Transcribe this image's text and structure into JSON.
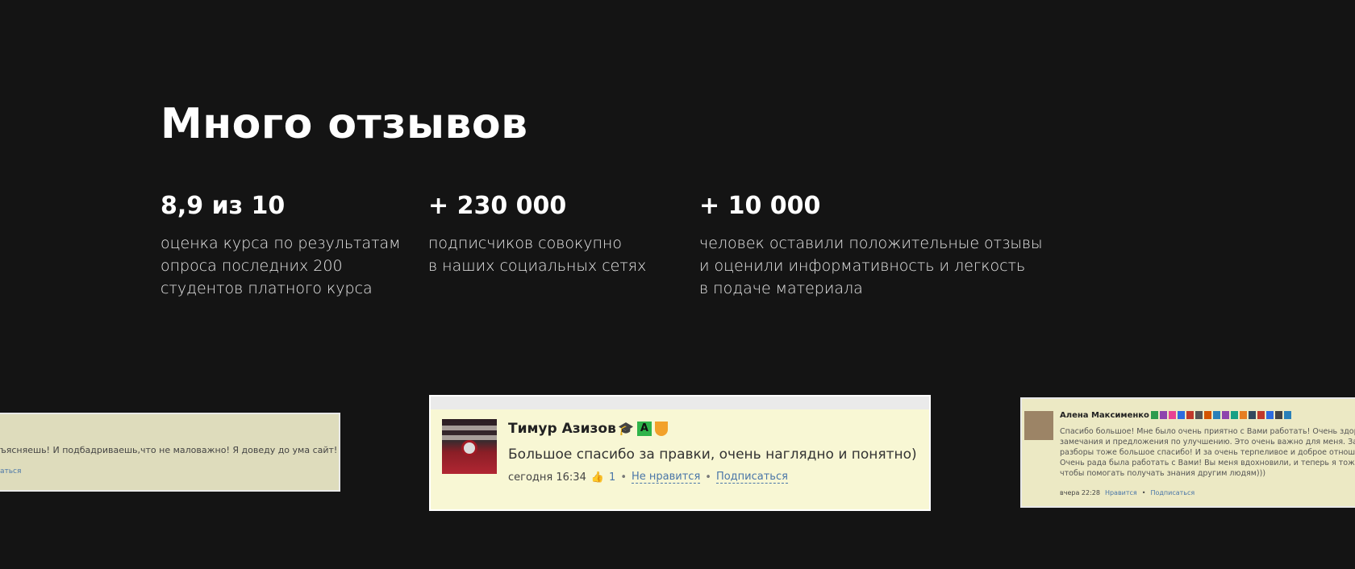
{
  "section": {
    "title": "Много отзывов"
  },
  "stats": [
    {
      "value": "8,9 из 10",
      "lines": [
        "оценка курса по результатам",
        "опроса последних 200",
        "студентов платного курса"
      ]
    },
    {
      "value": "+ 230 000",
      "lines": [
        "подписчиков совокупно",
        "в наших социальных сетях"
      ]
    },
    {
      "value": "+ 10 000",
      "lines": [
        "человек оставили положительные отзывы",
        "и оценили информативность и легкость",
        "в подаче материала"
      ]
    }
  ],
  "reviews": {
    "left": {
      "text": "ъясняешь! И подбадриваешь,что не маловажно! Я доведу до ума сайт! Уже работаю",
      "link": "аться"
    },
    "middle": {
      "author": "Тимур Азизов",
      "badge_letter": "A",
      "comment": "Большое спасибо за правки, очень наглядно и понятно)",
      "time": "сегодня 16:34",
      "likes": "1",
      "dislike": "Не нравится",
      "subscribe": "Подписаться"
    },
    "right": {
      "author": "Алена Максименко",
      "lines": [
        "Спасибо большое! Мне было очень приятно с Вами работать! Очень здоро",
        "замечания и предложения по улучшению. Это очень важно для меня. За ко",
        "разборы тоже большое спасибо! И за очень терпеливое и доброе отношен",
        "Очень рада была работать с Вами! Вы меня вдохновили, и теперь я тоже хо",
        "чтобы помогать получать знания другим людям)))"
      ],
      "time": "вчера 22:28",
      "like": "Нравится",
      "subscribe": "Подписаться"
    }
  },
  "colors": {
    "background": "#141414",
    "text": "#ffffff",
    "card_bg": "#f8f7d4",
    "link": "#4a76a8"
  }
}
